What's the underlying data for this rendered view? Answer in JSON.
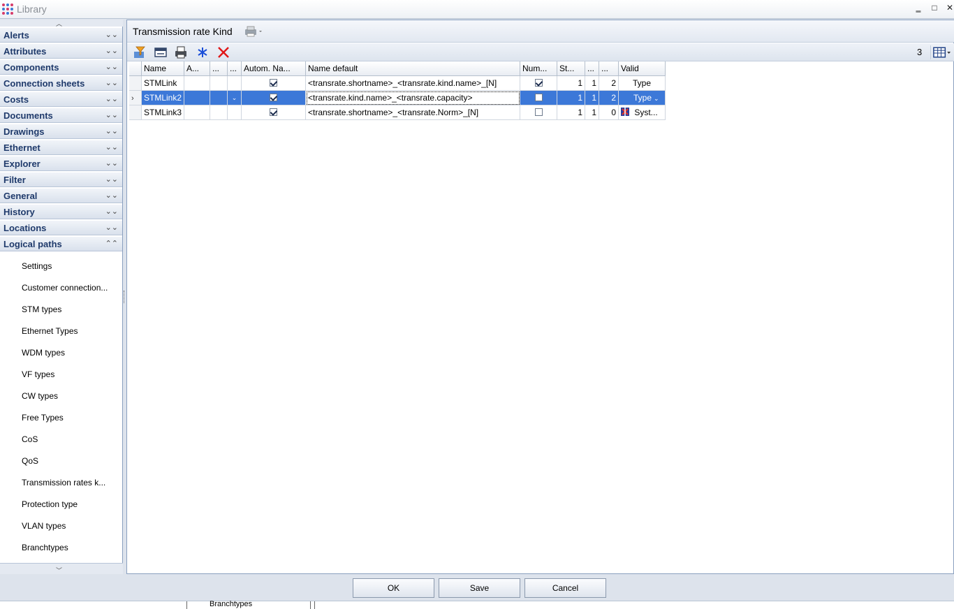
{
  "window": {
    "title": "Library",
    "minimize_glyph": "‗",
    "maximize_glyph": "□",
    "close_glyph": "✕",
    "icon": "app-dots-icon"
  },
  "sidebar": {
    "groups": [
      {
        "label": "Alerts"
      },
      {
        "label": "Attributes"
      },
      {
        "label": "Components"
      },
      {
        "label": "Connection sheets"
      },
      {
        "label": "Costs"
      },
      {
        "label": "Documents"
      },
      {
        "label": "Drawings"
      },
      {
        "label": "Ethernet"
      },
      {
        "label": "Explorer"
      },
      {
        "label": "Filter"
      },
      {
        "label": "General"
      },
      {
        "label": "History"
      },
      {
        "label": "Locations"
      },
      {
        "label": "Logical paths"
      }
    ],
    "expanded_group": "Logical paths",
    "items": [
      {
        "label": "Settings"
      },
      {
        "label": "Customer connection..."
      },
      {
        "label": "STM types"
      },
      {
        "label": "Ethernet Types"
      },
      {
        "label": "WDM types"
      },
      {
        "label": "VF types"
      },
      {
        "label": "CW types"
      },
      {
        "label": "Free Types"
      },
      {
        "label": "CoS"
      },
      {
        "label": "QoS"
      },
      {
        "label": "Transmission rates k..."
      },
      {
        "label": "Protection type"
      },
      {
        "label": "VLAN types"
      },
      {
        "label": "Branchtypes"
      }
    ]
  },
  "panel": {
    "title": "Transmission rate Kind",
    "record_count": "3",
    "toolbar_icons": [
      "filter-icon",
      "layout-icon",
      "print-icon",
      "freeze-icon",
      "delete-icon"
    ]
  },
  "grid": {
    "columns": [
      "Name",
      "A...",
      "...",
      "...",
      "Autom. Na...",
      "Name default",
      "Num...",
      "St...",
      "...",
      "...",
      "Valid"
    ],
    "rows": [
      {
        "name": "STMLink",
        "auto_name": true,
        "name_default": "<transrate.shortname>_<transrate.kind.name>_[N]",
        "num": true,
        "st": "1",
        "c9": "1",
        "c10": "2",
        "valid": "Type",
        "selected": false
      },
      {
        "name": "STMLink2",
        "auto_name": true,
        "name_default": "<transrate.kind.name>_<transrate.capacity>",
        "num": false,
        "st": "1",
        "c9": "1",
        "c10": "2",
        "valid": "Type",
        "selected": true
      },
      {
        "name": "STMLink3",
        "auto_name": true,
        "name_default": "<transrate.shortname>_<transrate.Norm>_[N]",
        "num": false,
        "st": "1",
        "c9": "1",
        "c10": "0",
        "valid": "Syst...",
        "selected": false
      }
    ]
  },
  "buttons": {
    "ok": "OK",
    "save": "Save",
    "cancel": "Cancel"
  },
  "statusbar": {
    "text": "Branchtypes"
  }
}
